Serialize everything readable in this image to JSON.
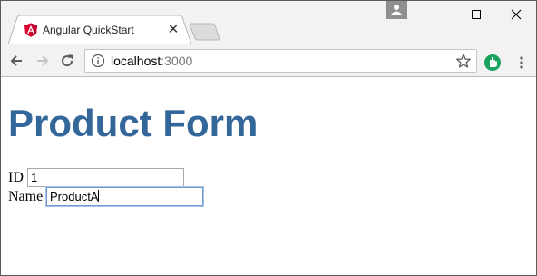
{
  "browser": {
    "tab": {
      "title": "Angular QuickStart",
      "favicon": "angular-icon",
      "close_glyph": "✕"
    },
    "address_bar": {
      "host": "localhost",
      "port": ":3000"
    },
    "icons": {
      "back": "back-arrow-icon",
      "forward": "forward-arrow-icon",
      "reload": "reload-icon",
      "info": "info-icon",
      "bookmark": "star-icon",
      "extension": "extension-icon",
      "menu": "kebab-menu-icon",
      "profile": "profile-icon"
    },
    "colors": {
      "chrome_bg": "#f2f2f2",
      "angular_red": "#dd0031",
      "extension_green": "#1aa260"
    }
  },
  "page": {
    "heading": "Product Form",
    "heading_color": "#336699",
    "fields": [
      {
        "label": "ID",
        "value": "1"
      },
      {
        "label": "Name",
        "value": "ProductA"
      }
    ]
  }
}
